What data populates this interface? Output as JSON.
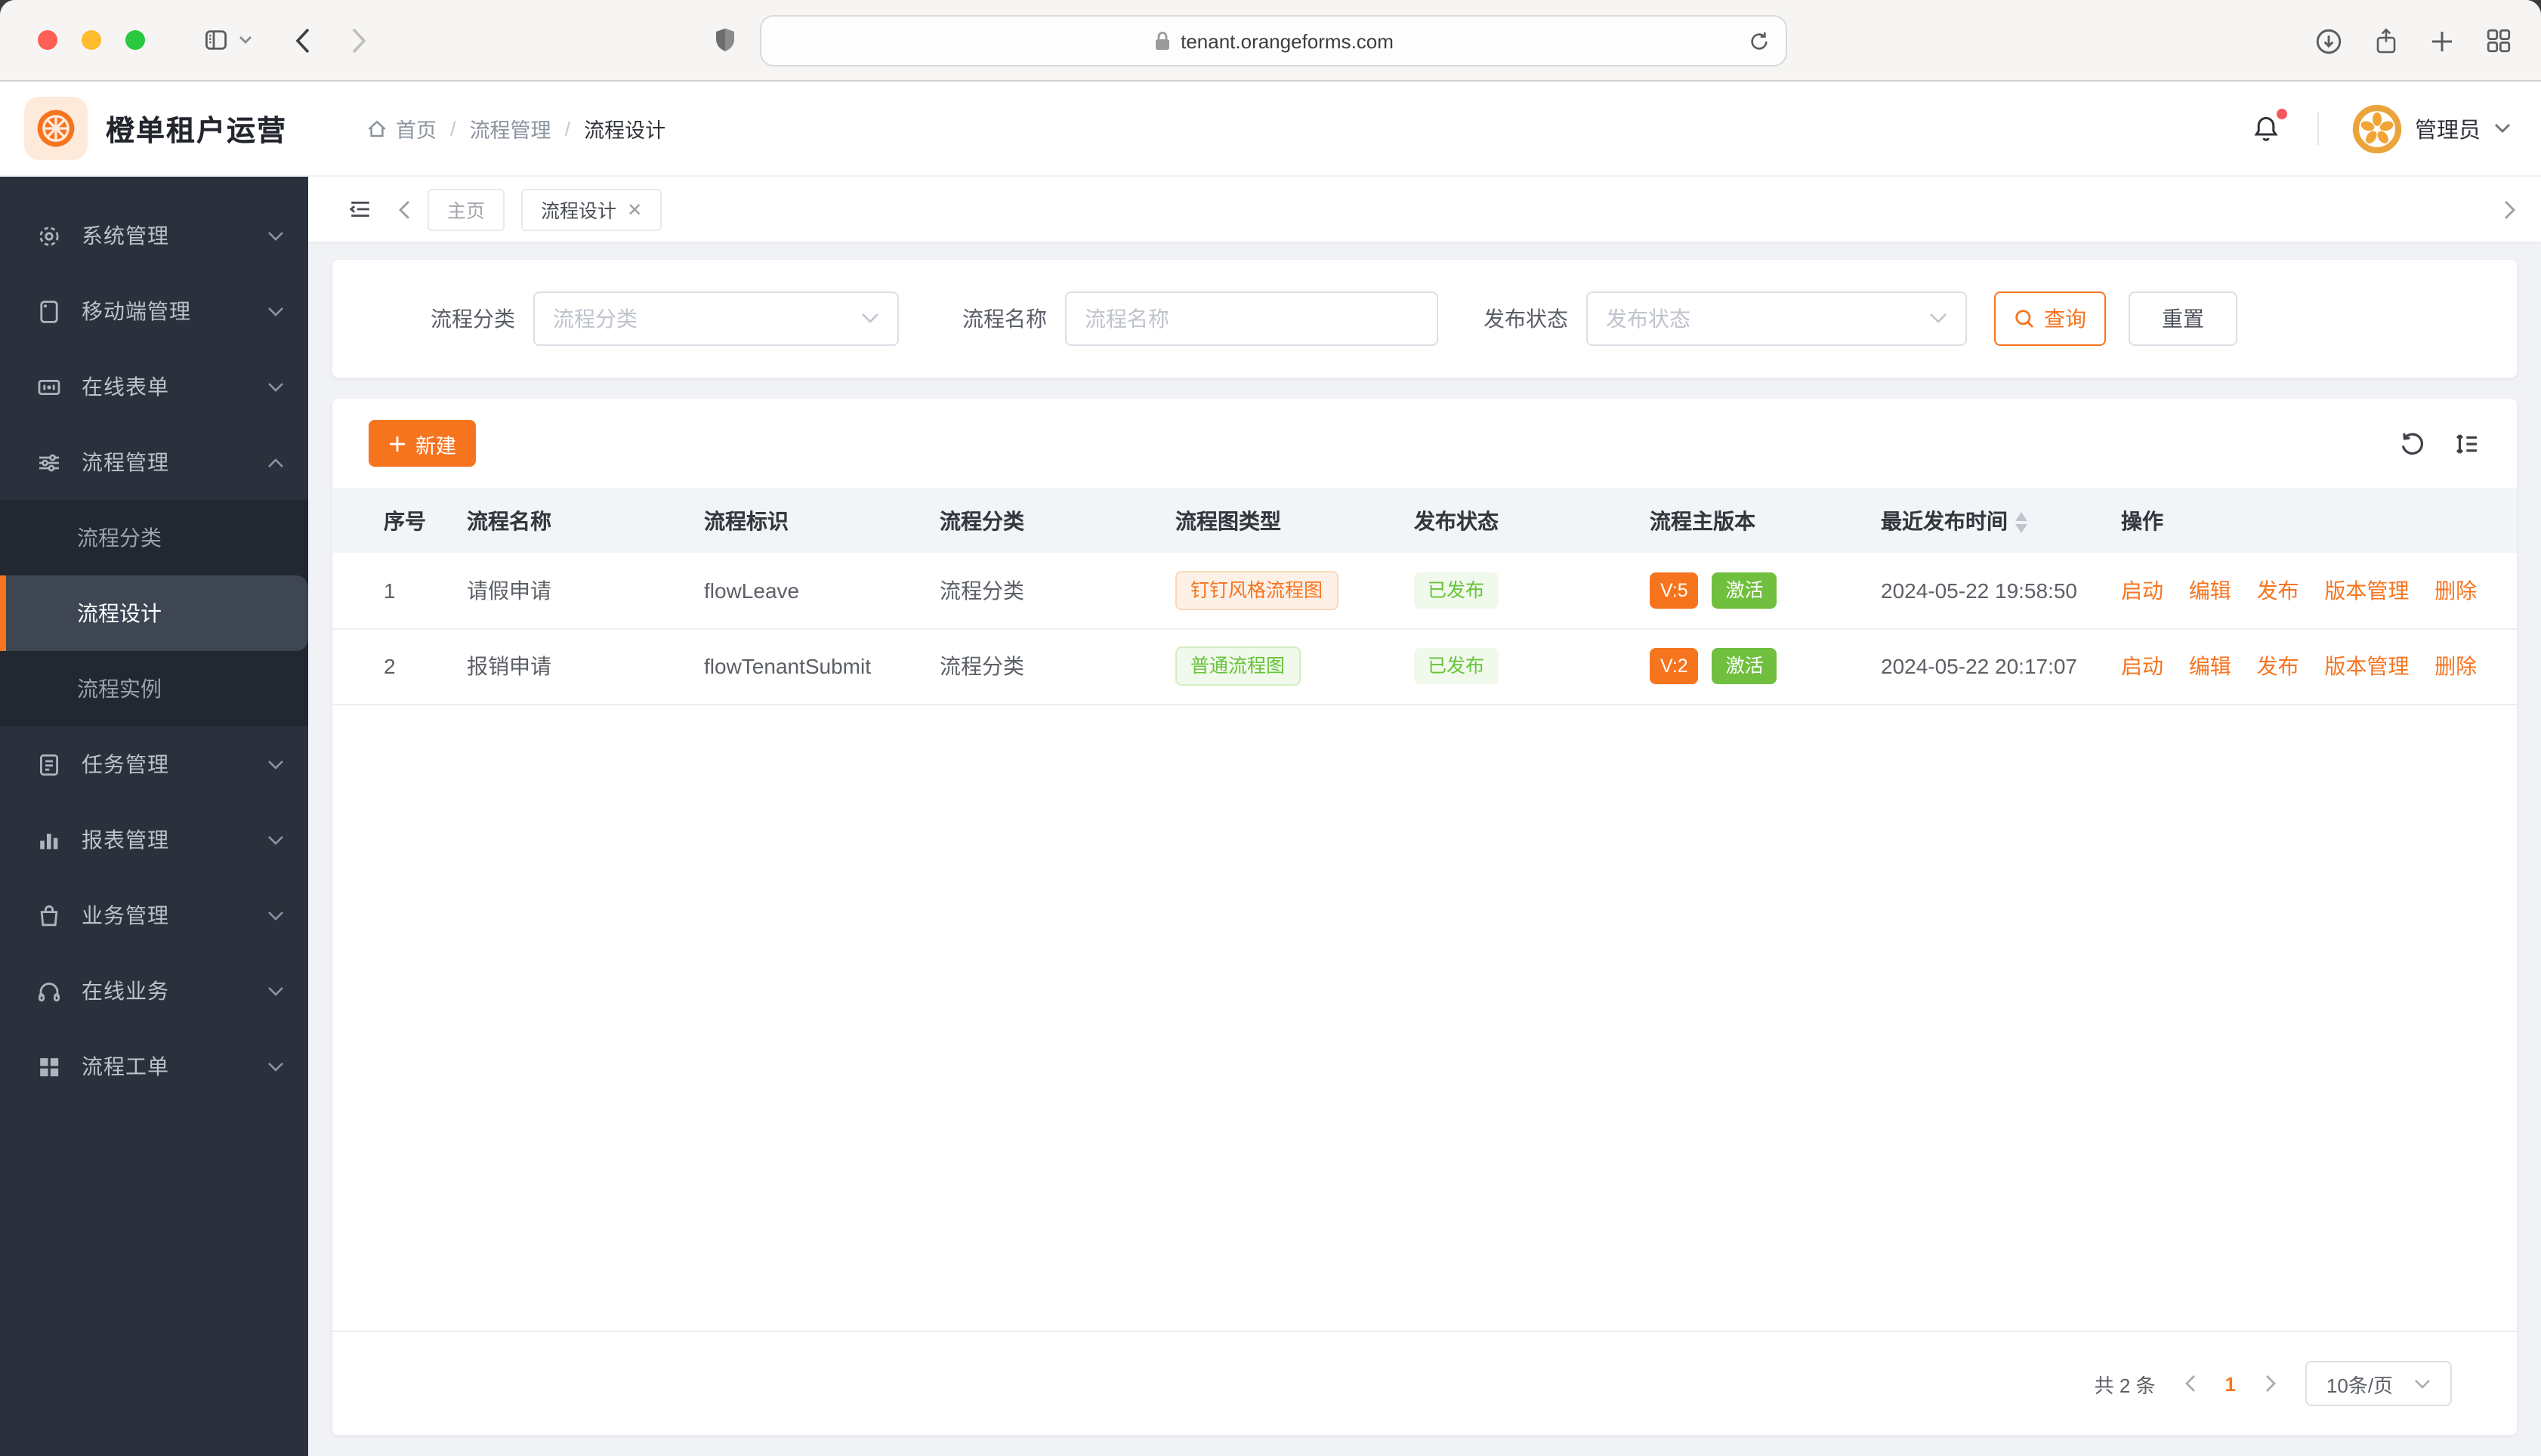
{
  "browser": {
    "url": "tenant.orangeforms.com"
  },
  "header": {
    "app_title": "橙单租户运营",
    "breadcrumb": {
      "items": [
        "首页",
        "流程管理",
        "流程设计"
      ],
      "separator": "/"
    },
    "user_name": "管理员"
  },
  "sidebar": {
    "items": [
      {
        "label": "系统管理",
        "icon": "gear-icon"
      },
      {
        "label": "移动端管理",
        "icon": "mobile-icon"
      },
      {
        "label": "在线表单",
        "icon": "form-icon"
      },
      {
        "label": "流程管理",
        "icon": "sliders-icon",
        "expanded": true,
        "children": [
          {
            "label": "流程分类",
            "active": false
          },
          {
            "label": "流程设计",
            "active": true
          },
          {
            "label": "流程实例",
            "active": false
          }
        ]
      },
      {
        "label": "任务管理",
        "icon": "tasks-icon"
      },
      {
        "label": "报表管理",
        "icon": "bar-chart-icon"
      },
      {
        "label": "业务管理",
        "icon": "bag-icon"
      },
      {
        "label": "在线业务",
        "icon": "headset-icon"
      },
      {
        "label": "流程工单",
        "icon": "grid-icon"
      }
    ]
  },
  "tabbar": {
    "tabs": [
      {
        "label": "主页",
        "active": false,
        "closable": false
      },
      {
        "label": "流程设计",
        "active": true,
        "closable": true
      }
    ]
  },
  "filters": {
    "category": {
      "label": "流程分类",
      "placeholder": "流程分类"
    },
    "name": {
      "label": "流程名称",
      "placeholder": "流程名称"
    },
    "status": {
      "label": "发布状态",
      "placeholder": "发布状态"
    },
    "search_button": "查询",
    "reset_button": "重置"
  },
  "toolbar": {
    "create_button": "新建"
  },
  "table": {
    "columns": [
      "序号",
      "流程名称",
      "流程标识",
      "流程分类",
      "流程图类型",
      "发布状态",
      "流程主版本",
      "最近发布时间",
      "操作"
    ],
    "rows": [
      {
        "seq": "1",
        "name": "请假申请",
        "key": "flowLeave",
        "category": "流程分类",
        "diagram_type": "钉钉风格流程图",
        "publish_status": "已发布",
        "version": "V:5",
        "state": "激活",
        "publish_time": "2024-05-22 19:58:50"
      },
      {
        "seq": "2",
        "name": "报销申请",
        "key": "flowTenantSubmit",
        "category": "流程分类",
        "diagram_type": "普通流程图",
        "publish_status": "已发布",
        "version": "V:2",
        "state": "激活",
        "publish_time": "2024-05-22 20:17:07"
      }
    ],
    "row_actions": [
      "启动",
      "编辑",
      "发布",
      "版本管理",
      "删除"
    ]
  },
  "pagination": {
    "total": "共 2 条",
    "page": "1",
    "page_size": "10条/页"
  },
  "colors": {
    "primary_orange": "#f7741f",
    "success_green_solid": "#70bf3f",
    "tag_green_text": "#67c23a",
    "tag_green_bg": "#f0f9eb",
    "tag_orange_bg": "#fdf1e7",
    "sidebar_bg": "#2b313c",
    "submenu_bg": "#222831",
    "active_item_bg": "#3e4553",
    "page_bg": "#f0f2f5"
  }
}
